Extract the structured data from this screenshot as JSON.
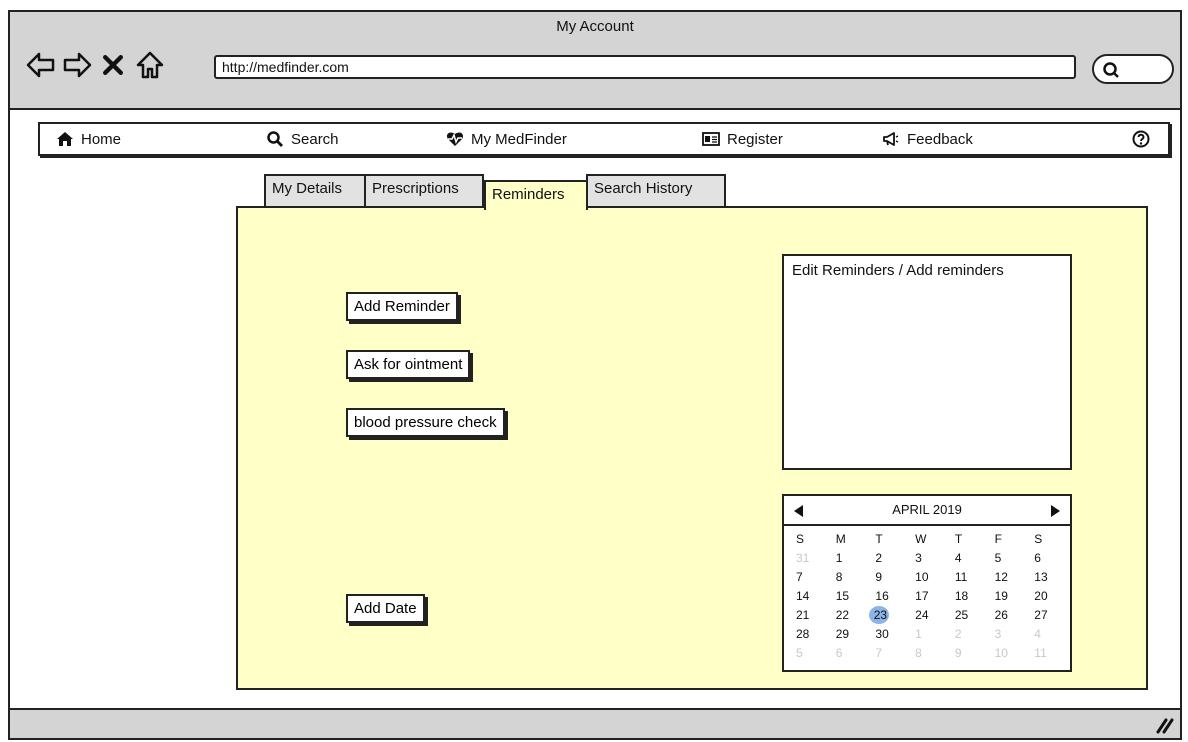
{
  "window": {
    "title": "My Account"
  },
  "address_bar": {
    "url": "http://medfinder.com"
  },
  "toolbar": {
    "back_icon": "back-arrow-icon",
    "forward_icon": "forward-arrow-icon",
    "close_icon": "x-icon",
    "home_icon": "home-outline-icon",
    "search_icon": "search-icon"
  },
  "menu": {
    "items": [
      {
        "label": "Home",
        "icon": "home-icon"
      },
      {
        "label": "Search",
        "icon": "search-icon"
      },
      {
        "label": "My MedFinder",
        "icon": "heartbeat-icon"
      },
      {
        "label": "Register",
        "icon": "id-card-icon"
      },
      {
        "label": "Feedback",
        "icon": "megaphone-icon"
      }
    ],
    "help_icon": "help-icon"
  },
  "tabs": [
    {
      "label": "My Details"
    },
    {
      "label": "Prescriptions"
    },
    {
      "label": "Reminders",
      "active": true
    },
    {
      "label": "Search History"
    }
  ],
  "reminders": {
    "add_reminder": "Add Reminder",
    "items": [
      "Ask for ointment",
      "blood pressure check"
    ],
    "add_date": "Add Date",
    "edit_box_label": "Edit Reminders / Add reminders"
  },
  "calendar": {
    "month": "APRIL 2019",
    "weekdays": [
      "S",
      "M",
      "T",
      "W",
      "T",
      "F",
      "S"
    ],
    "weeks": [
      [
        "31",
        "1",
        "2",
        "3",
        "4",
        "5",
        "6"
      ],
      [
        "7",
        "8",
        "9",
        "10",
        "11",
        "12",
        "13"
      ],
      [
        "14",
        "15",
        "16",
        "17",
        "18",
        "19",
        "20"
      ],
      [
        "21",
        "22",
        "23",
        "24",
        "25",
        "26",
        "27"
      ],
      [
        "28",
        "29",
        "30",
        "1",
        "2",
        "3",
        "4"
      ],
      [
        "5",
        "6",
        "7",
        "8",
        "9",
        "10",
        "11"
      ]
    ],
    "selected": "23",
    "accent_color": "#8db4e8"
  },
  "colors": {
    "panel_bg": "#ffffc8",
    "chrome_bg": "#d4d4d4",
    "inactive_tab_bg": "#e2e2e2"
  }
}
